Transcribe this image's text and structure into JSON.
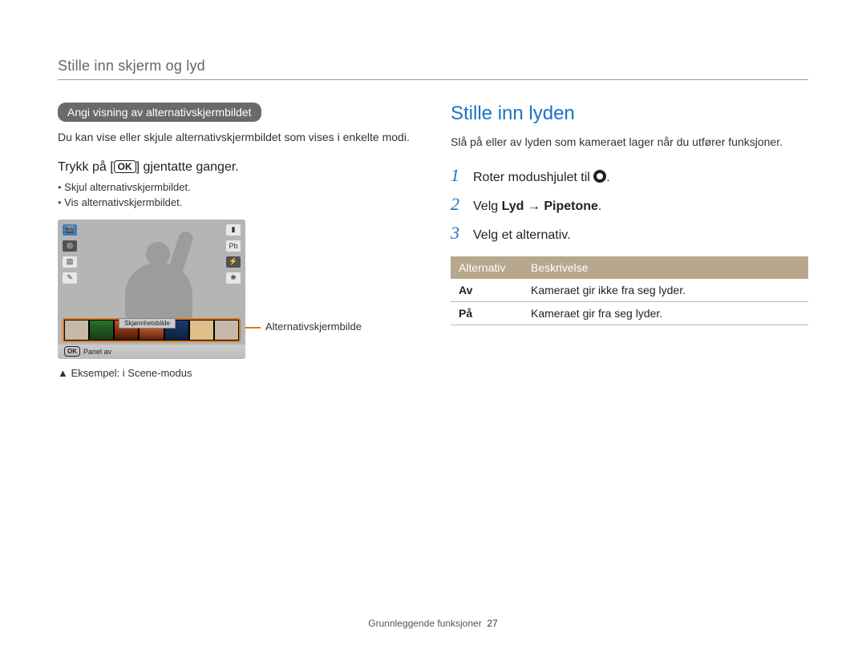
{
  "header": {
    "section_title": "Stille inn skjerm og lyd"
  },
  "left": {
    "pill": "Angi visning av alternativskjermbildet",
    "intro": "Du kan vise eller skjule alternativskjermbildet som vises i enkelte modi.",
    "press_prefix": "Trykk på [",
    "press_ok": "OK",
    "press_suffix": "] gjentatte ganger.",
    "bullets": [
      "Skjul alternativskjermbildet.",
      "Vis alternativskjermbildet."
    ],
    "lcd": {
      "chip_label": "Skjønnhetsbilde",
      "panel_ok": "OK",
      "panel_text": "Panel av"
    },
    "callout": "Alternativskjermbilde",
    "example_caption": "▲ Eksempel: i Scene-modus"
  },
  "right": {
    "heading": "Stille inn lyden",
    "intro": "Slå på eller av lyden som kameraet lager når du utfører funksjoner.",
    "steps": [
      {
        "num": "1",
        "prefix": "Roter modushjulet til ",
        "icon": "gear",
        "suffix": "."
      },
      {
        "num": "2",
        "prefix": "Velg ",
        "bold1": "Lyd",
        "arrow": " → ",
        "bold2": "Pipetone",
        "suffix": "."
      },
      {
        "num": "3",
        "prefix": "Velg et alternativ.",
        "suffix": ""
      }
    ],
    "table": {
      "head_option": "Alternativ",
      "head_desc": "Beskrivelse",
      "rows": [
        {
          "opt": "Av",
          "desc": "Kameraet gir ikke fra seg lyder."
        },
        {
          "opt": "På",
          "desc": "Kameraet gir fra seg lyder."
        }
      ]
    }
  },
  "footer": {
    "chapter": "Grunnleggende funksjoner",
    "page": "27"
  }
}
